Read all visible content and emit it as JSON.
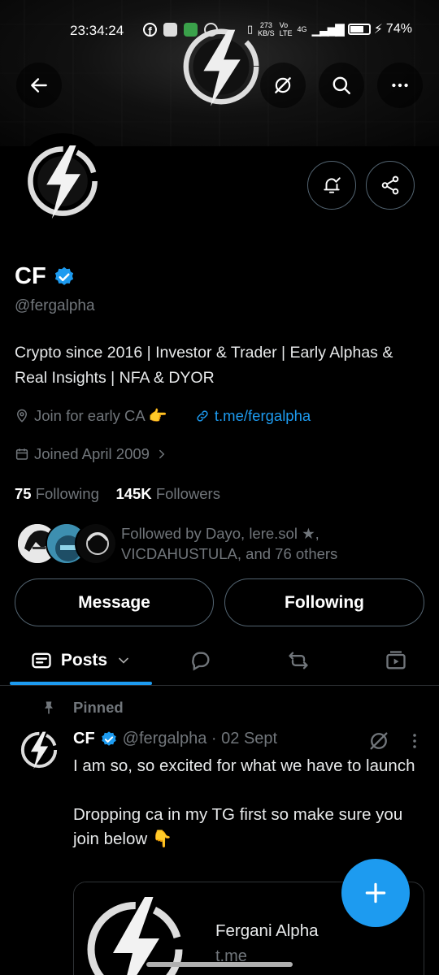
{
  "status_bar": {
    "time": "23:34:24",
    "net_speed_value": "273",
    "net_speed_unit": "KB/S",
    "signal_label": "4G",
    "battery": "74%"
  },
  "profile": {
    "name": "CF",
    "handle": "@fergalpha",
    "bio": "Crypto since 2016 | Investor & Trader | Early Alphas & Real Insights | NFA & DYOR",
    "location": "Join for early CA 👉",
    "link": "t.me/fergalpha",
    "joined": "Joined April 2009",
    "following_count": "75",
    "following_label": "Following",
    "followers_count": "145K",
    "followers_label": "Followers",
    "followed_by": "Followed by Dayo, lere.sol ★, VICDAHUSTULA, and 76 others"
  },
  "actions": {
    "message": "Message",
    "following": "Following"
  },
  "tabs": {
    "posts": "Posts"
  },
  "tweet": {
    "pinned_label": "Pinned",
    "name": "CF",
    "handle_date": "@fergalpha · 02 Sept",
    "text_line1": "I am so, so excited for what we have to launch",
    "text_line2": "Dropping ca in my TG first so make sure you join below 👇",
    "card_title": "Fergani Alpha",
    "card_domain": "t.me"
  },
  "colors": {
    "accent": "#1d9bf0",
    "muted": "#71767b",
    "border": "#536471"
  }
}
